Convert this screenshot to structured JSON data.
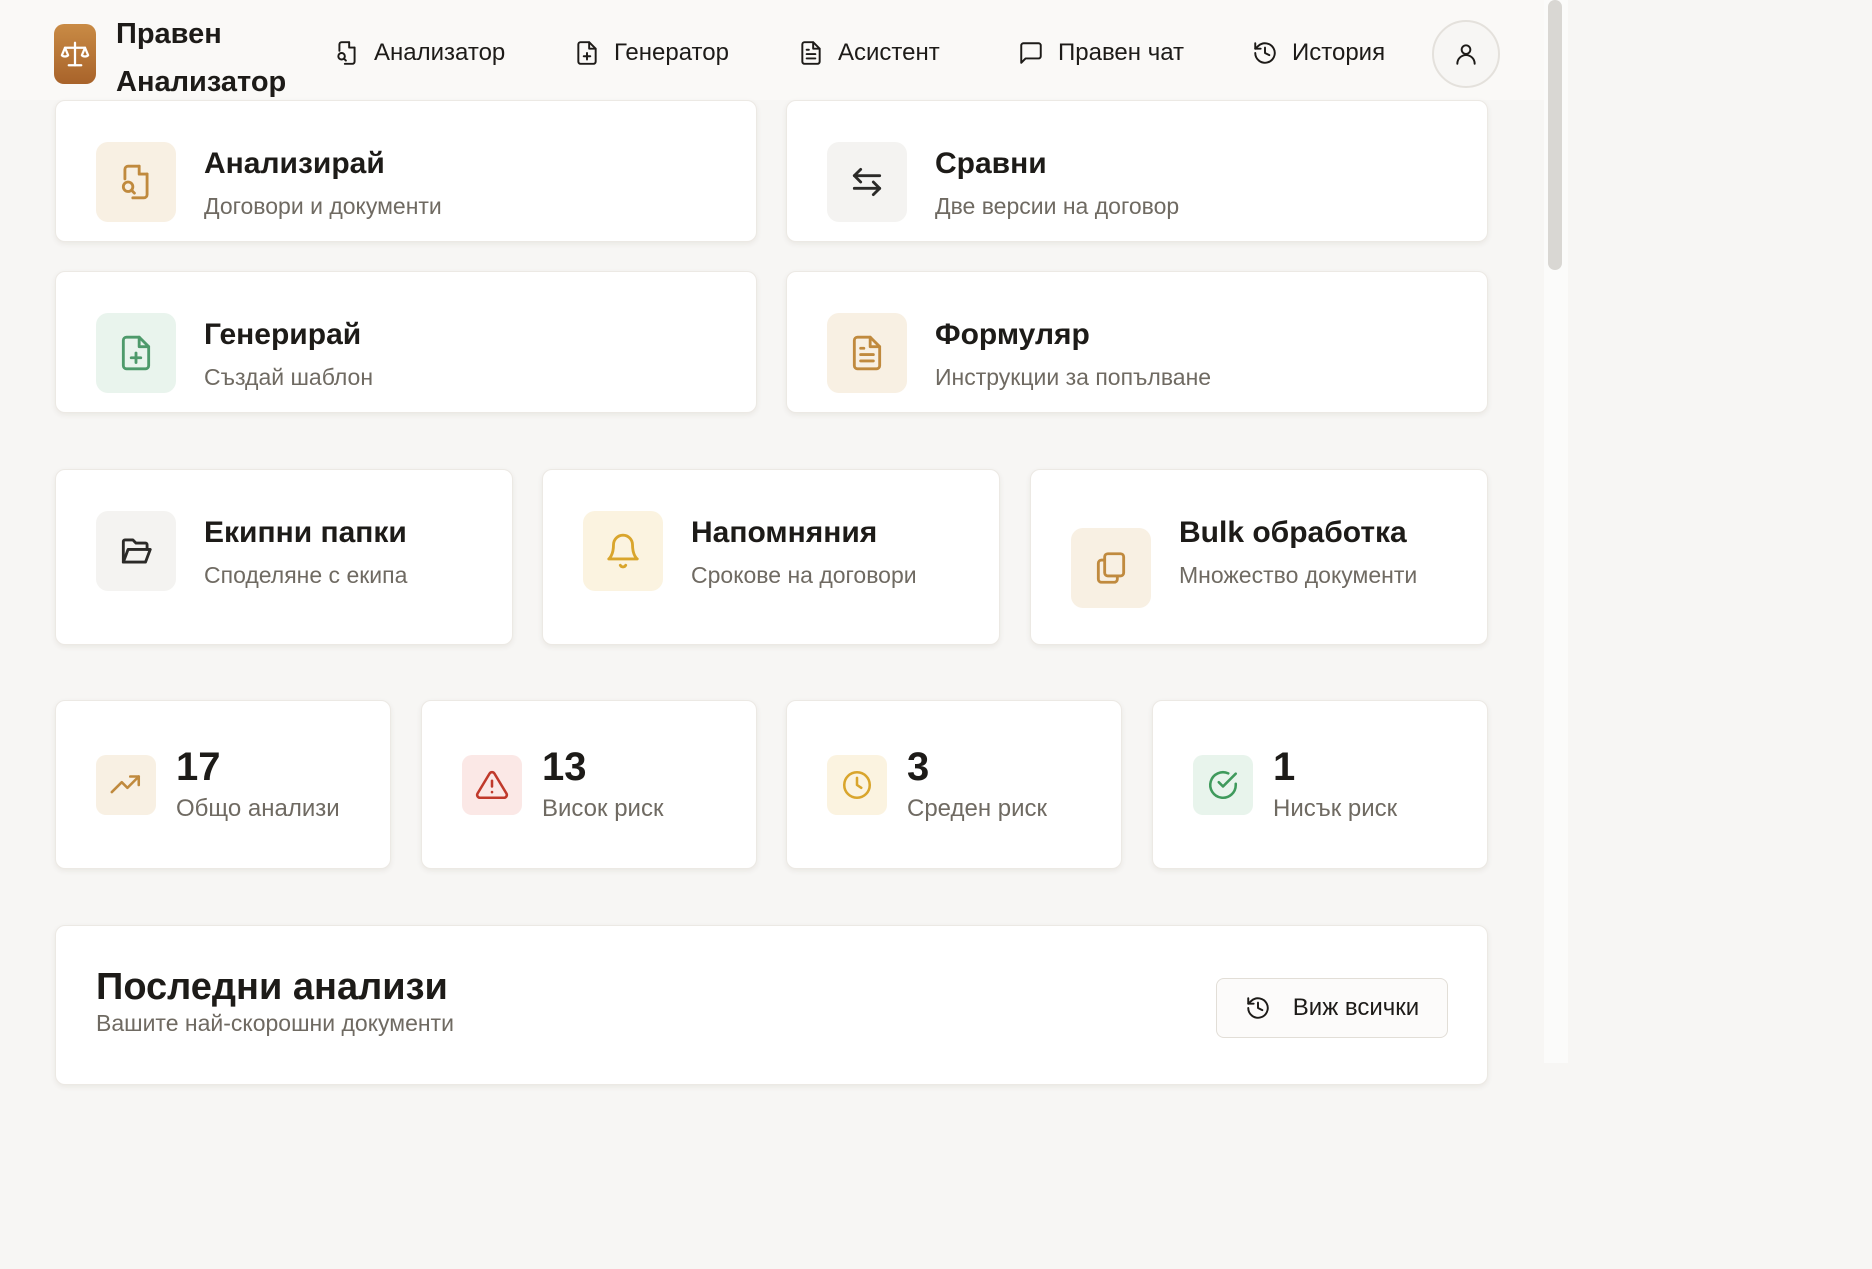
{
  "header": {
    "brand_line1": "Правен",
    "brand_line2": "Анализатор",
    "nav": [
      {
        "label": "Анализатор",
        "icon": "file-search-icon"
      },
      {
        "label": "Генератор",
        "icon": "file-plus-icon"
      },
      {
        "label": "Асистент",
        "icon": "file-text-icon"
      },
      {
        "label": "Правен чат",
        "icon": "message-square-icon"
      },
      {
        "label": "История",
        "icon": "history-icon"
      }
    ],
    "user_icon": "user-icon"
  },
  "actions": [
    {
      "title": "Анализирай",
      "subtitle": "Договори и документи",
      "icon": "file-search-icon",
      "color": "#c08a3e"
    },
    {
      "title": "Сравни",
      "subtitle": "Две версии на договор",
      "icon": "arrows-left-right-icon",
      "color": "#2b2a28"
    },
    {
      "title": "Генерирай",
      "subtitle": "Създай шаблон",
      "icon": "file-plus-icon",
      "color": "#4e9a6b"
    },
    {
      "title": "Формуляр",
      "subtitle": "Инструкции за попълване",
      "icon": "file-text-icon",
      "color": "#c08a3e"
    }
  ],
  "features": [
    {
      "title": "Екипни папки",
      "subtitle": "Споделяне с екипа",
      "icon": "folder-open-icon",
      "color": "#2b2a28"
    },
    {
      "title": "Напомняния",
      "subtitle": "Срокове на договори",
      "icon": "bell-icon",
      "color": "#d9a52c"
    },
    {
      "title": "Bulk обработка",
      "subtitle": "Множество документи",
      "icon": "copy-icon",
      "color": "#c08a3e"
    }
  ],
  "stats": [
    {
      "value": "17",
      "label": "Общо анализи",
      "icon": "trending-up-icon",
      "color": "#c08a3e"
    },
    {
      "value": "13",
      "label": "Висок риск",
      "icon": "alert-triangle-icon",
      "color": "#c0392b"
    },
    {
      "value": "3",
      "label": "Среден риск",
      "icon": "clock-icon",
      "color": "#d9a52c"
    },
    {
      "value": "1",
      "label": "Нисък риск",
      "icon": "check-circle-icon",
      "color": "#3f9a5c"
    }
  ],
  "recent": {
    "title": "Последни анализи",
    "subtitle": "Вашите най-скорошни документи",
    "view_all": "Виж всички",
    "view_all_icon": "history-icon"
  }
}
